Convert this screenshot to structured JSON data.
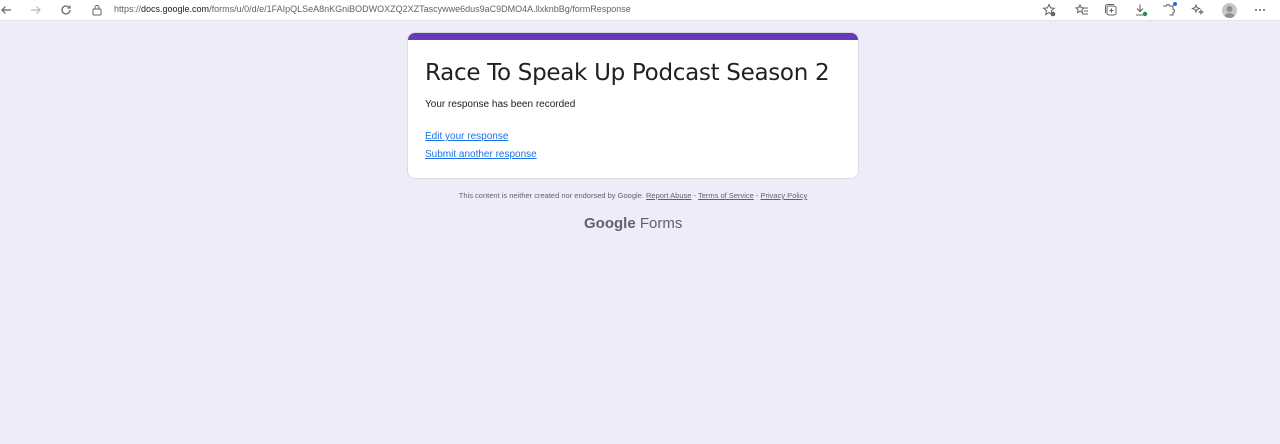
{
  "browser": {
    "url_prefix": "https://",
    "url_host": "docs.google.com",
    "url_path": "/forms/u/0/d/e/1FAIpQLSeA8nKGniBODWOXZQ2XZTascywwe6dus9aC9DMO4A.llxknbBg/formResponse"
  },
  "form": {
    "title": "Race To Speak Up Podcast Season 2",
    "confirmation": "Your response has been recorded",
    "edit_link": "Edit your response",
    "submit_another_link": "Submit another response"
  },
  "footer": {
    "disclaimer": "This content is neither created nor endorsed by Google.",
    "report_abuse": "Report Abuse",
    "terms": "Terms of Service",
    "privacy": "Privacy Policy",
    "sep1": " - ",
    "sep2": " - ",
    "brand_google": "Google",
    "brand_forms": "Forms"
  },
  "colors": {
    "accent": "#673ab7",
    "background": "#f0ebf8",
    "link": "#1a73e8"
  }
}
